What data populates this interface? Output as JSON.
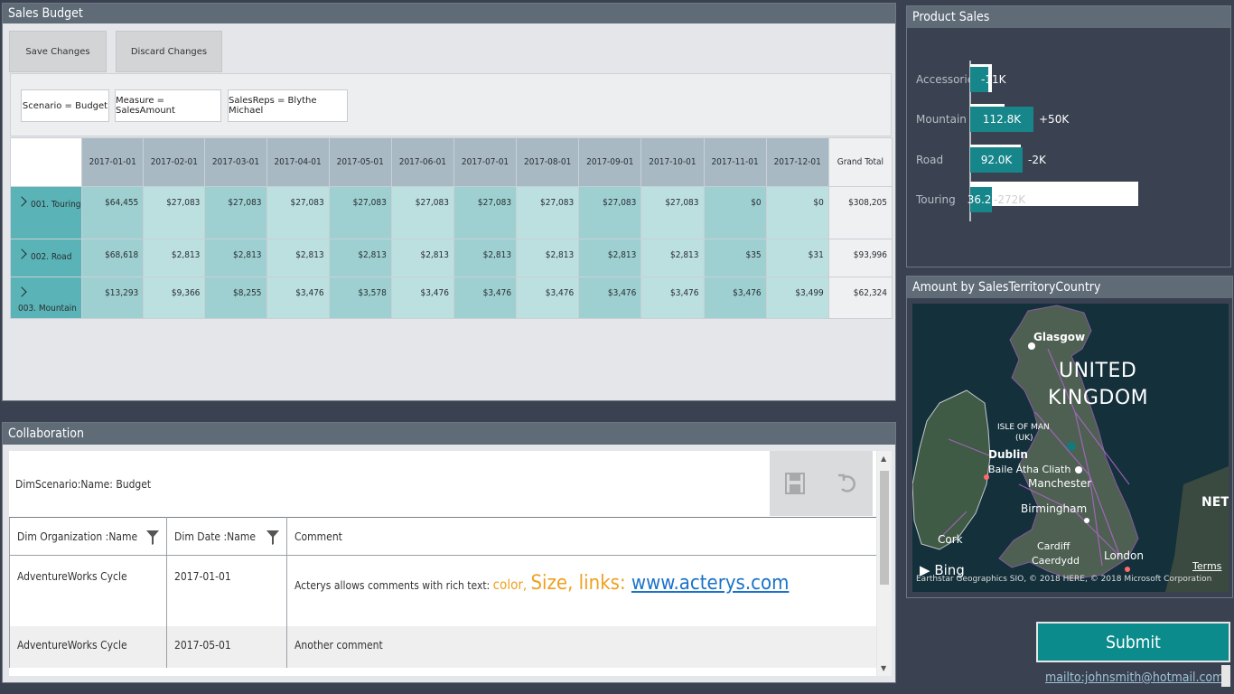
{
  "budget": {
    "title": "Sales Budget",
    "save_label": "Save Changes",
    "discard_label": "Discard Changes",
    "filters": [
      "Scenario = Budget",
      "Measure = SalesAmount",
      "SalesReps = Blythe Michael"
    ],
    "columns": [
      "2017-01-01",
      "2017-02-01",
      "2017-03-01",
      "2017-04-01",
      "2017-05-01",
      "2017-06-01",
      "2017-07-01",
      "2017-08-01",
      "2017-09-01",
      "2017-10-01",
      "2017-11-01",
      "2017-12-01",
      "Grand Total"
    ],
    "rows": [
      {
        "label": "001. Touring",
        "values": [
          "$64,455",
          "$27,083",
          "$27,083",
          "$27,083",
          "$27,083",
          "$27,083",
          "$27,083",
          "$27,083",
          "$27,083",
          "$27,083",
          "$0",
          "$0",
          "$308,205"
        ]
      },
      {
        "label": "002. Road",
        "values": [
          "$68,618",
          "$2,813",
          "$2,813",
          "$2,813",
          "$2,813",
          "$2,813",
          "$2,813",
          "$2,813",
          "$2,813",
          "$2,813",
          "$35",
          "$31",
          "$93,996"
        ]
      },
      {
        "label": "003. Mountain",
        "values": [
          "$13,293",
          "$9,366",
          "$8,255",
          "$3,476",
          "$3,578",
          "$3,476",
          "$3,476",
          "$3,476",
          "$3,476",
          "$3,476",
          "$3,476",
          "$3,499",
          "$62,324"
        ]
      }
    ]
  },
  "collab": {
    "title": "Collaboration",
    "scenario": "DimScenario:Name: Budget",
    "save_icon": "save-icon",
    "undo_icon": "undo-icon",
    "headers": [
      "Dim Organization :Name",
      "Dim Date :Name",
      "Comment"
    ],
    "rows": [
      {
        "org": "AdventureWorks Cycle",
        "date": "2017-01-01",
        "comment_prefix": "Acterys allows comments with rich text: ",
        "comment_color": "color, ",
        "comment_size": "Size, links: ",
        "comment_link": "www.acterys.com"
      },
      {
        "org": "AdventureWorks Cycle",
        "date": "2017-05-01",
        "comment": "Another comment"
      }
    ]
  },
  "product_sales": {
    "title": "Product Sales",
    "colors": {
      "bar": "#17868a",
      "target": "#ffffff",
      "axis": "#e6e6e6",
      "label": "#b8bec6"
    },
    "items": [
      {
        "name": "Accessories",
        "value_label": "",
        "variance_label": "-11K"
      },
      {
        "name": "Mountain",
        "value_label": "112.8K",
        "variance_label": "+50K"
      },
      {
        "name": "Road",
        "value_label": "92.0K",
        "variance_label": "-2K"
      },
      {
        "name": "Touring",
        "value_label": "36.2K",
        "variance_label": "-272K"
      }
    ]
  },
  "map": {
    "title": "Amount by SalesTerritoryCountry",
    "labels": {
      "glasgow": "Glasgow",
      "uk_line1": "UNITED",
      "uk_line2": "KINGDOM",
      "isle_of_man": "ISLE OF MAN",
      "isle_of_man_sub": "(UK)",
      "dublin": "Dublin",
      "dublin_irish": "Baile Átha Cliath",
      "manchester": "Manchester",
      "birmingham": "Birmingham",
      "cork": "Cork",
      "cardiff": "Cardiff",
      "cardiff_welsh": "Caerdydd",
      "london": "London",
      "neth": "NETH",
      "bing": "Bing",
      "terms": "Terms",
      "attribution": "Earthstar Geographics SIO, © 2018 HERE, © 2018 Microsoft Corporation"
    }
  },
  "submit_label": "Submit",
  "mail_link": "mailto:johnsmith@hotmail.com"
}
